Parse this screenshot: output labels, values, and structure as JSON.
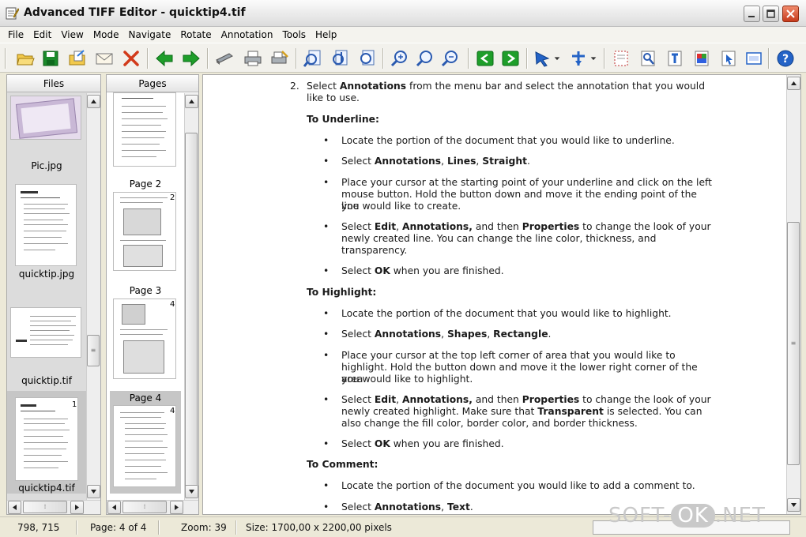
{
  "window": {
    "title": "Advanced TIFF Editor - quicktip4.tif"
  },
  "menu": [
    "File",
    "Edit",
    "View",
    "Mode",
    "Navigate",
    "Rotate",
    "Annotation",
    "Tools",
    "Help"
  ],
  "toolbar": {
    "icons": [
      "open-folder-icon",
      "save-icon",
      "open-file-icon",
      "email-icon",
      "close-red-x-icon",
      "back-arrow-icon",
      "forward-arrow-icon",
      "scanner-icon",
      "print-icon",
      "print-setup-icon",
      "fit-width-icon",
      "fit-height-icon",
      "fit-page-icon",
      "zoom-in-icon",
      "zoom-actual-icon",
      "zoom-out-icon",
      "previous-page-icon",
      "next-page-icon",
      "pointer-tool-icon",
      "pan-tool-icon",
      "select-rectangle-icon",
      "magnifier-tool-icon",
      "text-tool-icon",
      "color-tool-icon",
      "cursor-tool-icon",
      "edit-tool-icon",
      "help-icon"
    ]
  },
  "files_panel": {
    "header": "Files",
    "items": [
      {
        "label": "Pic.jpg"
      },
      {
        "label": "quicktip.jpg"
      },
      {
        "label": "quicktip.tif"
      },
      {
        "label": "quicktip4.tif",
        "num": "1",
        "selected": true
      }
    ]
  },
  "pages_panel": {
    "header": "Pages",
    "items": [
      {
        "label": "Page 2",
        "num": "2"
      },
      {
        "label": "Page 3",
        "num": "3"
      },
      {
        "label": "Page 4",
        "num": "4",
        "selected": true
      }
    ]
  },
  "document": {
    "step_num": "2.",
    "step_a": "Select ",
    "step_b": "Annotations",
    "step_c": " from the menu bar and select the annotation that you would",
    "step_d": "like to use.",
    "h_underline": "To Underline:",
    "u1": "Locate the portion of the document that you would like to underline.",
    "u2_a": "Select ",
    "u2_b": "Annotations",
    "u2_c": ", ",
    "u2_d": "Lines",
    "u2_e": ", ",
    "u2_f": "Straight",
    "u2_g": ".",
    "u3_l1": "Place your cursor at the starting point of your underline and click on the left",
    "u3_l2": "mouse button. Hold the button down and move it the ending point of the line",
    "u3_l3": "you would like to create.",
    "u4_a": "Select ",
    "u4_b": "Edit",
    "u4_c": ", ",
    "u4_d": "Annotations,",
    "u4_e": " and then ",
    "u4_f": "Properties",
    "u4_g": " to change the look of your",
    "u4_l2": "newly created line. You can change the line color, thickness, and",
    "u4_l3": "transparency.",
    "u5_a": "Select ",
    "u5_b": "OK",
    "u5_c": " when you are finished.",
    "h_highlight": "To Highlight:",
    "h1": "Locate the portion of the document that you would like to highlight.",
    "h2_a": "Select ",
    "h2_b": "Annotations",
    "h2_c": ", ",
    "h2_d": "Shapes",
    "h2_e": ", ",
    "h2_f": "Rectangle",
    "h2_g": ".",
    "h3_l1": "Place your cursor at the top left corner of area that you would like to",
    "h3_l2": "highlight. Hold the button down and move it the lower right corner of the area",
    "h3_l3": "you would like to highlight.",
    "h4_a": "Select ",
    "h4_b": "Edit",
    "h4_c": ", ",
    "h4_d": "Annotations,",
    "h4_e": " and then ",
    "h4_f": "Properties",
    "h4_g": " to change the look of your",
    "h4_l2a": "newly created highlight. Make sure that ",
    "h4_l2b": "Transparent",
    "h4_l2c": " is selected. You can",
    "h4_l3": "also change the fill color, border color, and border thickness.",
    "h5_a": "Select ",
    "h5_b": "OK",
    "h5_c": " when you are finished.",
    "h_comment": "To Comment:",
    "c1": "Locate the portion of the document you would like to add a comment to.",
    "c2_a": "Select ",
    "c2_b": "Annotations",
    "c2_c": ", ",
    "c2_d": "Text",
    "c2_e": ".",
    "bullet": "•"
  },
  "status": {
    "coords": "798, 715",
    "page": "Page: 4 of 4",
    "zoom": "Zoom: 39",
    "size": "Size: 1700,00 x 2200,00 pixels"
  },
  "watermark": {
    "a": "SOFT-",
    "b": "OK",
    "c": ".NET"
  },
  "colors": {
    "green_arrow": "#1e9e2a",
    "blue_help": "#2463c6",
    "close_red": "#d23a1a"
  }
}
